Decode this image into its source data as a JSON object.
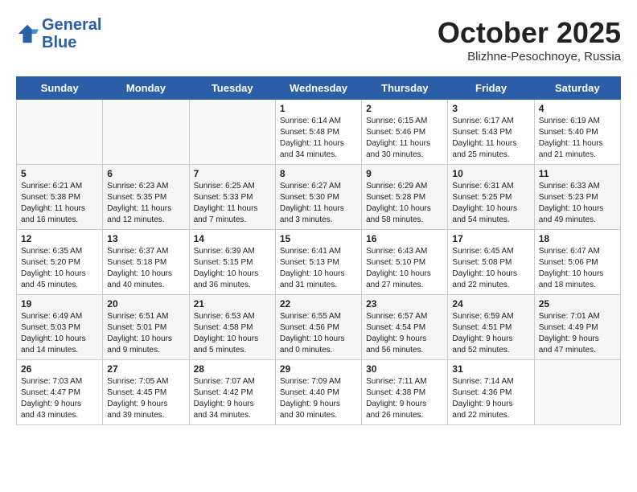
{
  "header": {
    "logo_line1": "General",
    "logo_line2": "Blue",
    "month": "October 2025",
    "location": "Blizhne-Pesochnoye, Russia"
  },
  "days_of_week": [
    "Sunday",
    "Monday",
    "Tuesday",
    "Wednesday",
    "Thursday",
    "Friday",
    "Saturday"
  ],
  "weeks": [
    [
      {
        "day": "",
        "text": ""
      },
      {
        "day": "",
        "text": ""
      },
      {
        "day": "",
        "text": ""
      },
      {
        "day": "1",
        "text": "Sunrise: 6:14 AM\nSunset: 5:48 PM\nDaylight: 11 hours\nand 34 minutes."
      },
      {
        "day": "2",
        "text": "Sunrise: 6:15 AM\nSunset: 5:46 PM\nDaylight: 11 hours\nand 30 minutes."
      },
      {
        "day": "3",
        "text": "Sunrise: 6:17 AM\nSunset: 5:43 PM\nDaylight: 11 hours\nand 25 minutes."
      },
      {
        "day": "4",
        "text": "Sunrise: 6:19 AM\nSunset: 5:40 PM\nDaylight: 11 hours\nand 21 minutes."
      }
    ],
    [
      {
        "day": "5",
        "text": "Sunrise: 6:21 AM\nSunset: 5:38 PM\nDaylight: 11 hours\nand 16 minutes."
      },
      {
        "day": "6",
        "text": "Sunrise: 6:23 AM\nSunset: 5:35 PM\nDaylight: 11 hours\nand 12 minutes."
      },
      {
        "day": "7",
        "text": "Sunrise: 6:25 AM\nSunset: 5:33 PM\nDaylight: 11 hours\nand 7 minutes."
      },
      {
        "day": "8",
        "text": "Sunrise: 6:27 AM\nSunset: 5:30 PM\nDaylight: 11 hours\nand 3 minutes."
      },
      {
        "day": "9",
        "text": "Sunrise: 6:29 AM\nSunset: 5:28 PM\nDaylight: 10 hours\nand 58 minutes."
      },
      {
        "day": "10",
        "text": "Sunrise: 6:31 AM\nSunset: 5:25 PM\nDaylight: 10 hours\nand 54 minutes."
      },
      {
        "day": "11",
        "text": "Sunrise: 6:33 AM\nSunset: 5:23 PM\nDaylight: 10 hours\nand 49 minutes."
      }
    ],
    [
      {
        "day": "12",
        "text": "Sunrise: 6:35 AM\nSunset: 5:20 PM\nDaylight: 10 hours\nand 45 minutes."
      },
      {
        "day": "13",
        "text": "Sunrise: 6:37 AM\nSunset: 5:18 PM\nDaylight: 10 hours\nand 40 minutes."
      },
      {
        "day": "14",
        "text": "Sunrise: 6:39 AM\nSunset: 5:15 PM\nDaylight: 10 hours\nand 36 minutes."
      },
      {
        "day": "15",
        "text": "Sunrise: 6:41 AM\nSunset: 5:13 PM\nDaylight: 10 hours\nand 31 minutes."
      },
      {
        "day": "16",
        "text": "Sunrise: 6:43 AM\nSunset: 5:10 PM\nDaylight: 10 hours\nand 27 minutes."
      },
      {
        "day": "17",
        "text": "Sunrise: 6:45 AM\nSunset: 5:08 PM\nDaylight: 10 hours\nand 22 minutes."
      },
      {
        "day": "18",
        "text": "Sunrise: 6:47 AM\nSunset: 5:06 PM\nDaylight: 10 hours\nand 18 minutes."
      }
    ],
    [
      {
        "day": "19",
        "text": "Sunrise: 6:49 AM\nSunset: 5:03 PM\nDaylight: 10 hours\nand 14 minutes."
      },
      {
        "day": "20",
        "text": "Sunrise: 6:51 AM\nSunset: 5:01 PM\nDaylight: 10 hours\nand 9 minutes."
      },
      {
        "day": "21",
        "text": "Sunrise: 6:53 AM\nSunset: 4:58 PM\nDaylight: 10 hours\nand 5 minutes."
      },
      {
        "day": "22",
        "text": "Sunrise: 6:55 AM\nSunset: 4:56 PM\nDaylight: 10 hours\nand 0 minutes."
      },
      {
        "day": "23",
        "text": "Sunrise: 6:57 AM\nSunset: 4:54 PM\nDaylight: 9 hours\nand 56 minutes."
      },
      {
        "day": "24",
        "text": "Sunrise: 6:59 AM\nSunset: 4:51 PM\nDaylight: 9 hours\nand 52 minutes."
      },
      {
        "day": "25",
        "text": "Sunrise: 7:01 AM\nSunset: 4:49 PM\nDaylight: 9 hours\nand 47 minutes."
      }
    ],
    [
      {
        "day": "26",
        "text": "Sunrise: 7:03 AM\nSunset: 4:47 PM\nDaylight: 9 hours\nand 43 minutes."
      },
      {
        "day": "27",
        "text": "Sunrise: 7:05 AM\nSunset: 4:45 PM\nDaylight: 9 hours\nand 39 minutes."
      },
      {
        "day": "28",
        "text": "Sunrise: 7:07 AM\nSunset: 4:42 PM\nDaylight: 9 hours\nand 34 minutes."
      },
      {
        "day": "29",
        "text": "Sunrise: 7:09 AM\nSunset: 4:40 PM\nDaylight: 9 hours\nand 30 minutes."
      },
      {
        "day": "30",
        "text": "Sunrise: 7:11 AM\nSunset: 4:38 PM\nDaylight: 9 hours\nand 26 minutes."
      },
      {
        "day": "31",
        "text": "Sunrise: 7:14 AM\nSunset: 4:36 PM\nDaylight: 9 hours\nand 22 minutes."
      },
      {
        "day": "",
        "text": ""
      }
    ]
  ]
}
